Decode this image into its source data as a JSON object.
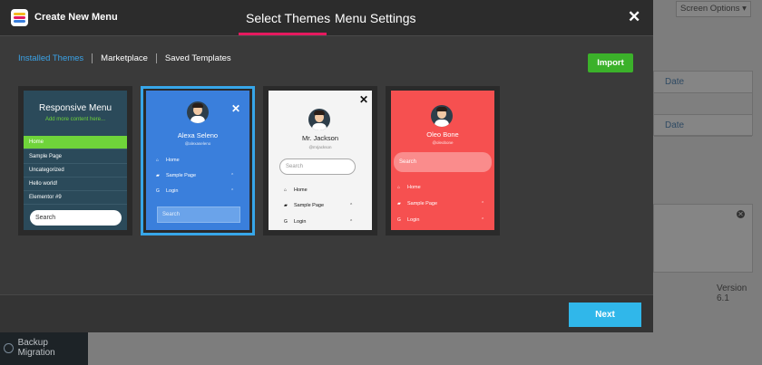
{
  "header": {
    "app_title": "Create New Menu",
    "tabs": [
      "Select Themes",
      "Menu Settings"
    ],
    "close_icon": "close-icon"
  },
  "sub_tabs": [
    "Installed Themes",
    "Marketplace",
    "Saved Templates"
  ],
  "import_label": "Import",
  "themes": [
    {
      "title": "Responsive Menu",
      "subtitle": "Add more content here...",
      "items": [
        "Home",
        "Sample Page",
        "Uncategorized",
        "Hello world!",
        "Elementor #9"
      ],
      "search": "Search"
    },
    {
      "name": "Alexa Seleno",
      "handle": "@alexaseleno",
      "items": [
        "Home",
        "Sample Page",
        "Login"
      ],
      "search": "Search"
    },
    {
      "name": "Mr. Jackson",
      "handle": "@mrjackson",
      "items": [
        "Home",
        "Sample Page",
        "Login"
      ],
      "search": "Search"
    },
    {
      "name": "Oleo Bone",
      "handle": "@oleobone",
      "items": [
        "Home",
        "Sample Page",
        "Login"
      ],
      "search": "Search"
    }
  ],
  "next_label": "Next",
  "background": {
    "screen_options": "Screen Options ▾",
    "date_1": "Date",
    "date_2": "Date",
    "version": "Version 6.1",
    "sidebar_item": "Backup Migration"
  },
  "colors": {
    "accent": "#e5195f",
    "import": "#3bb12a",
    "next": "#30b7ea",
    "selected_border": "#37a6e8"
  }
}
